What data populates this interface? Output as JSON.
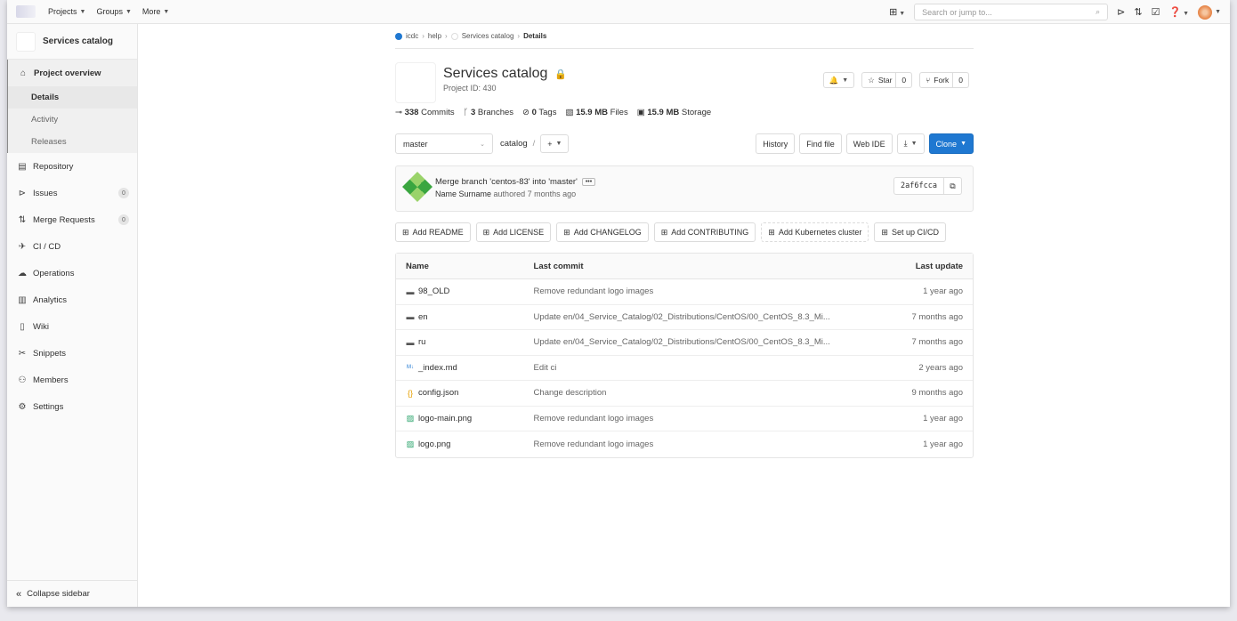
{
  "topnav": {
    "projects": "Projects",
    "groups": "Groups",
    "more": "More",
    "search_placeholder": "Search or jump to..."
  },
  "sidebar": {
    "project_name": "Services catalog",
    "project_overview": "Project overview",
    "sub_items": [
      "Details",
      "Activity",
      "Releases"
    ],
    "items": [
      {
        "label": "Repository",
        "icon": "book-icon"
      },
      {
        "label": "Issues",
        "icon": "issues-icon",
        "badge": "0"
      },
      {
        "label": "Merge Requests",
        "icon": "merge-request-icon",
        "badge": "0"
      },
      {
        "label": "CI / CD",
        "icon": "rocket-icon"
      },
      {
        "label": "Operations",
        "icon": "cloud-icon"
      },
      {
        "label": "Analytics",
        "icon": "chart-icon"
      },
      {
        "label": "Wiki",
        "icon": "wiki-icon"
      },
      {
        "label": "Snippets",
        "icon": "scissors-icon"
      },
      {
        "label": "Members",
        "icon": "users-icon"
      },
      {
        "label": "Settings",
        "icon": "gear-icon"
      }
    ],
    "collapse": "Collapse sidebar"
  },
  "breadcrumb": {
    "group": "icdc",
    "subgroup": "help",
    "project": "Services catalog",
    "current": "Details"
  },
  "project": {
    "title": "Services catalog",
    "id": "Project ID: 430",
    "star_label": "Star",
    "star_count": "0",
    "fork_label": "Fork",
    "fork_count": "0"
  },
  "stats": {
    "commits_num": "338",
    "commits_label": "Commits",
    "branches_num": "3",
    "branches_label": "Branches",
    "tags_num": "0",
    "tags_label": "Tags",
    "files_num": "15.9 MB",
    "files_label": "Files",
    "storage_num": "15.9 MB",
    "storage_label": "Storage"
  },
  "toolbar": {
    "branch": "master",
    "path": "catalog",
    "path_sep": "/",
    "history": "History",
    "find_file": "Find file",
    "web_ide": "Web IDE",
    "clone": "Clone"
  },
  "commit": {
    "message": "Merge branch 'centos-83' into 'master'",
    "author": "Name Surname",
    "authored": "authored 7 months ago",
    "sha": "2af6fcca"
  },
  "actions": [
    "Add README",
    "Add LICENSE",
    "Add CHANGELOG",
    "Add CONTRIBUTING",
    "Add Kubernetes cluster",
    "Set up CI/CD"
  ],
  "table": {
    "headers": {
      "name": "Name",
      "commit": "Last commit",
      "update": "Last update"
    },
    "rows": [
      {
        "name": "98_OLD",
        "icon": "folder-icon",
        "commit": "Remove redundant logo images",
        "update": "1 year ago"
      },
      {
        "name": "en",
        "icon": "folder-icon",
        "commit": "Update en/04_Service_Catalog/02_Distributions/CentOS/00_CentOS_8.3_Mi...",
        "update": "7 months ago"
      },
      {
        "name": "ru",
        "icon": "folder-icon",
        "commit": "Update en/04_Service_Catalog/02_Distributions/CentOS/00_CentOS_8.3_Mi...",
        "update": "7 months ago"
      },
      {
        "name": "_index.md",
        "icon": "markdown-icon",
        "commit": "Edit ci",
        "update": "2 years ago"
      },
      {
        "name": "config.json",
        "icon": "json-icon",
        "commit": "Change description",
        "update": "9 months ago"
      },
      {
        "name": "logo-main.png",
        "icon": "image-icon",
        "commit": "Remove redundant logo images",
        "update": "1 year ago"
      },
      {
        "name": "logo.png",
        "icon": "image-icon",
        "commit": "Remove redundant logo images",
        "update": "1 year ago"
      }
    ]
  },
  "colors": {
    "primary": "#1f78d1",
    "sidebar_bg": "#fafafa"
  }
}
